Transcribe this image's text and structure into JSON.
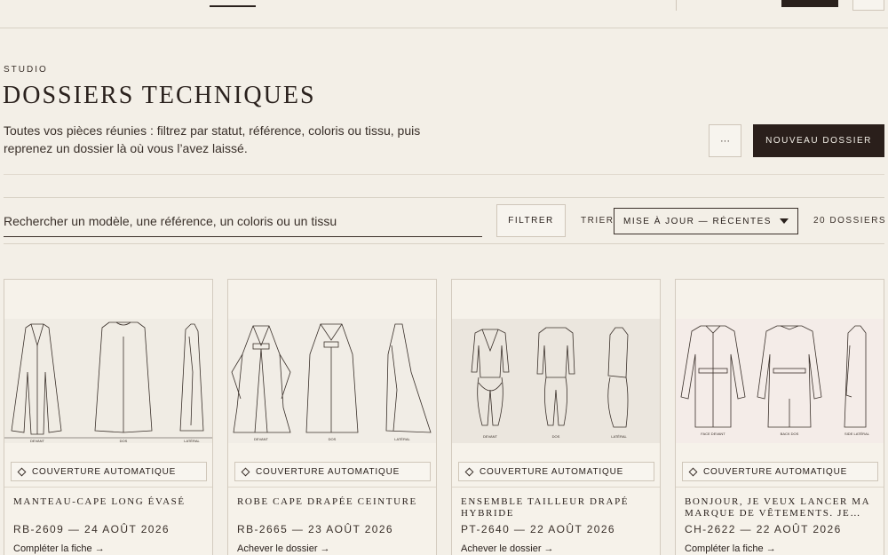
{
  "header": {
    "eyebrow": "STUDIO",
    "title": "DOSSIERS TECHNIQUES",
    "description": "Toutes vos pièces réunies : filtrez par statut, référence, coloris ou tissu, puis reprenez un dossier là où vous l’avez laissé.",
    "more_label": "···",
    "new_label": "NOUVEAU DOSSIER"
  },
  "toolbar": {
    "search_placeholder": "Rechercher un modèle, une référence, un coloris ou un tissu",
    "filter_label": "FILTRER",
    "sort_label": "TRIER",
    "sort_value": "MISE À JOUR — RÉCENTES",
    "count": "20 DOSSIERS"
  },
  "cards": [
    {
      "chip": "COUVERTURE AUTOMATIQUE",
      "name": "MANTEAU-CAPE LONG ÉVASÉ",
      "ref": "RB-2609 — 24 AOÛT 2026",
      "action": "Compléter la fiche →",
      "view_labels": [
        "DEVANT",
        "DOS",
        "LATÉRAL"
      ],
      "bg": "#f0ece4"
    },
    {
      "chip": "COUVERTURE AUTOMATIQUE",
      "name": "ROBE CAPE DRAPÉE CEINTURE",
      "ref": "RB-2665 — 23 AOÛT 2026",
      "action": "Achever le dossier →",
      "view_labels": [
        "DEVANT",
        "DOS",
        "LATÉRAL"
      ],
      "bg": "#f1ede6"
    },
    {
      "chip": "COUVERTURE AUTOMATIQUE",
      "name": "ENSEMBLE TAILLEUR DRAPÉ HYBRIDE",
      "ref": "PT-2640 — 22 AOÛT 2026",
      "action": "Achever le dossier →",
      "view_labels": [
        "DEVANT",
        "DOS",
        "LATÉRAL"
      ],
      "bg": "#ebe6de"
    },
    {
      "chip": "COUVERTURE AUTOMATIQUE",
      "name": "BONJOUR, JE VEUX LANCER MA MARQUE DE VÊTEMENTS. JE…",
      "ref": "CH-2622 — 22 AOÛT 2026",
      "action": "Compléter la fiche →",
      "view_labels": [
        "FACE DEVANT",
        "BACK DOS",
        "SIDE LATÉRAL"
      ],
      "bg": "#f4ece8"
    }
  ]
}
